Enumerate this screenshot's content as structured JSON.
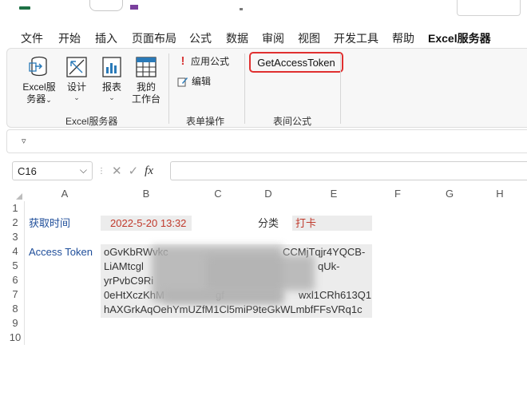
{
  "tabs": [
    "文件",
    "开始",
    "插入",
    "页面布局",
    "公式",
    "数据",
    "审阅",
    "视图",
    "开发工具",
    "帮助",
    "Excel服务器"
  ],
  "active_tab_index": 10,
  "ribbon": {
    "group_excel_server": {
      "label": "Excel服务器",
      "buttons": [
        {
          "label_line1": "Excel服",
          "label_line2": "务器",
          "caret": "⌄",
          "icon": "database-icon"
        },
        {
          "label_line1": "设计",
          "label_line2": "",
          "caret": "⌄",
          "icon": "design-icon"
        },
        {
          "label_line1": "报表",
          "label_line2": "",
          "caret": "⌄",
          "icon": "report-icon"
        },
        {
          "label_line1": "我的",
          "label_line2": "工作台",
          "caret": "",
          "icon": "workbench-icon"
        }
      ]
    },
    "group_form_ops": {
      "label": "表单操作",
      "apply_formula": "应用公式",
      "edit": "编辑"
    },
    "group_table_formula": {
      "label": "表间公式",
      "get_access_token": "GetAccessToken"
    }
  },
  "qat": {
    "customize_glyph": "▿"
  },
  "formula_bar": {
    "name_box": "C16",
    "dropdown_glyph": "⌵",
    "cancel_glyph": "✕",
    "enter_glyph": "✓",
    "fx_label": "fx",
    "value": ""
  },
  "sheet": {
    "columns": [
      "A",
      "B",
      "C",
      "D",
      "E",
      "F",
      "G",
      "H"
    ],
    "rows": [
      "1",
      "2",
      "3",
      "4",
      "5",
      "6",
      "7",
      "8",
      "9",
      "10"
    ],
    "cells": {
      "A2": "获取时间",
      "B2": "2022-5-20 13:32",
      "D2": "分类",
      "E2": "打卡",
      "A4": "Access Token",
      "token_line1_left": "oGvKbRWvkc",
      "token_line1_right": "CCMjTqjr4YQCB-",
      "token_line2_left": "LiAMtcgl",
      "token_line2_right": "qUk-",
      "token_line3_left": "yrPvbC9Ri",
      "token_line4_left": "0eHtXczKhM",
      "token_line4_mid": "gf",
      "token_line4_right": "wxl1CRh613Q1",
      "token_line5": "hAXGrkAqOehYmUZfM1Cl5miP9teGkWLmbfFFsVRq1c"
    }
  },
  "colors": {
    "accent_green": "#1e7145",
    "highlight_red": "#e03030",
    "label_blue": "#1f4e9a",
    "value_red": "#c0392b"
  }
}
